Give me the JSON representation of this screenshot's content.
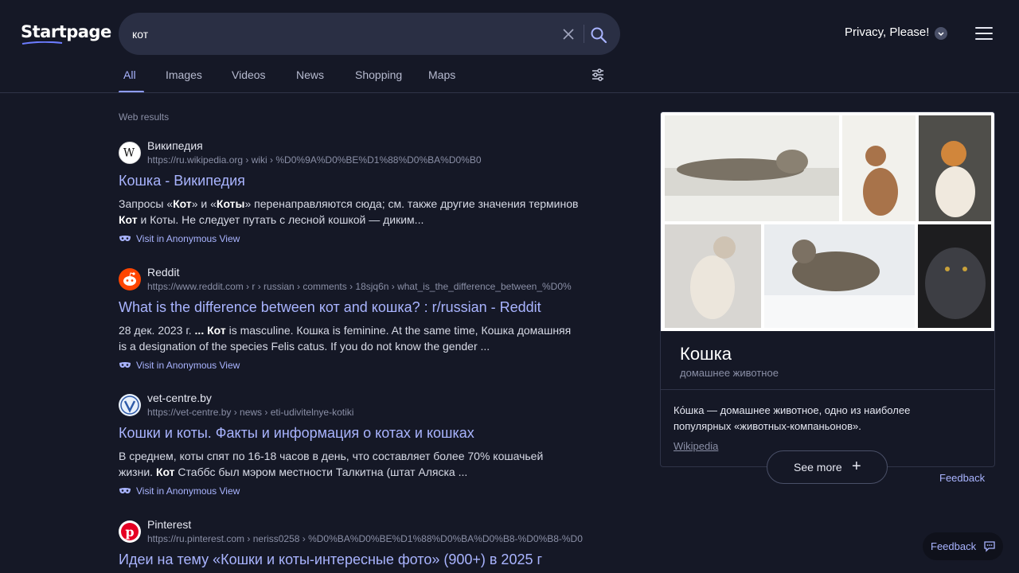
{
  "header": {
    "logo": "Startpage",
    "search_value": "кот",
    "privacy_label": "Privacy, Please!"
  },
  "tabs": [
    {
      "label": "All",
      "active": true
    },
    {
      "label": "Images"
    },
    {
      "label": "Videos"
    },
    {
      "label": "News"
    },
    {
      "label": "Shopping"
    },
    {
      "label": "Maps"
    }
  ],
  "web_results_label": "Web results",
  "results": [
    {
      "site": "Википедия",
      "url": "https://ru.wikipedia.org › wiki › %D0%9A%D0%BE%D1%88%D0%BA%D0%B0",
      "title": "Кошка - Википедия",
      "snippet_parts": [
        "Запросы «",
        "Кот",
        "» и «",
        "Коты",
        "» перенаправляются сюда; см. также другие значения терминов ",
        "Кот",
        " и Коты. Не следует путать с лесной кошкой — диким..."
      ],
      "anon": "Visit in Anonymous View",
      "favicon": "wikipedia-icon"
    },
    {
      "site": "Reddit",
      "url": "https://www.reddit.com › r › russian › comments › 18sjq6n › what_is_the_difference_between_%D0%",
      "title": "What is the difference between кот and кошка? : r/russian - Reddit",
      "snippet_parts": [
        "28 дек. 2023 г. ",
        "... Кот",
        " is masculine. Кошка is feminine. At the same time, Кошка домашняя is a designation of the species Felis catus. If you do not know the gender ..."
      ],
      "anon": "Visit in Anonymous View",
      "favicon": "reddit-icon"
    },
    {
      "site": "vet-centre.by",
      "url": "https://vet-centre.by › news › eti-udivitelnye-kotiki",
      "title": "Кошки и коты. Факты и информация о котах и кошках",
      "snippet_parts": [
        "В среднем, коты спят по 16-18 часов в день, что составляет более 70% кошачьей жизни. ",
        "Кот",
        " Стаббс был мэром местности Талкитна (штат Аляска ..."
      ],
      "anon": "Visit in Anonymous View",
      "favicon": "vet-centre-icon"
    },
    {
      "site": "Pinterest",
      "url": "https://ru.pinterest.com › neriss0258 › %D0%BA%D0%BE%D1%88%D0%BA%D0%B8-%D0%B8-%D0",
      "title": "Идеи на тему «Кошки и коты-интересные фото» (900+) в 2025 г",
      "favicon": "pinterest-icon"
    }
  ],
  "knowledge_panel": {
    "title": "Кошка",
    "subtitle": "домашнее животное",
    "description": "Ко́шка — домашнее животное, одно из наиболее популярных «животных-компаньонов».",
    "source": "Wikipedia",
    "see_more": "See more",
    "feedback": "Feedback"
  },
  "floating_feedback": "Feedback",
  "colors": {
    "background": "#151826",
    "link": "#a9b4ff",
    "search_box": "#2a2f44"
  }
}
